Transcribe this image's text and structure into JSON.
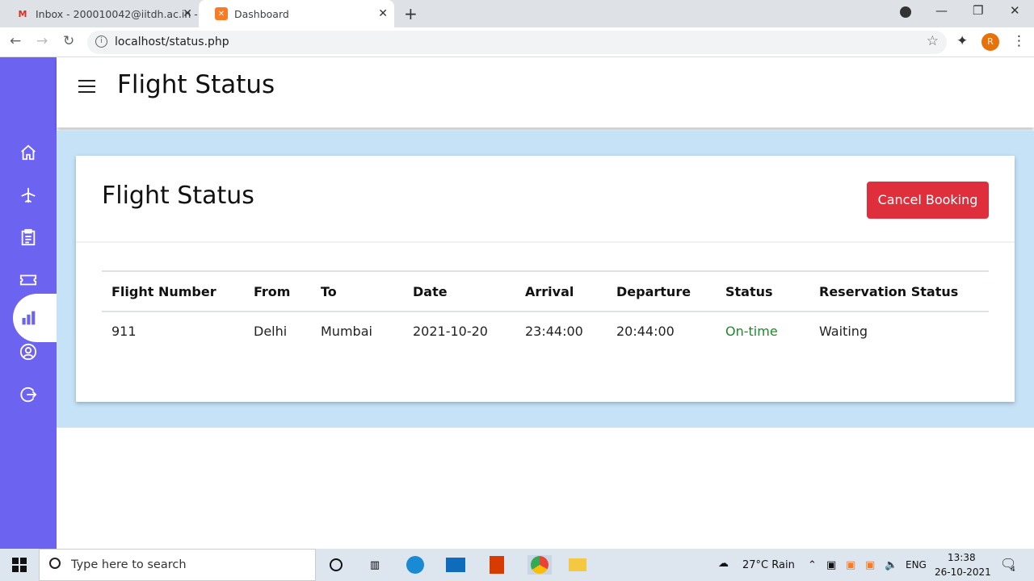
{
  "browser": {
    "tabs": [
      {
        "title": "Inbox - 200010042@iitdh.ac.in - ",
        "favicon": "gmail-icon"
      },
      {
        "title": "Dashboard",
        "favicon": "xampp-icon"
      }
    ],
    "url": "localhost/status.php",
    "profile_initial": "R"
  },
  "app": {
    "header_title": "Flight Status",
    "sidebar": [
      {
        "icon": "home-icon"
      },
      {
        "icon": "plane-icon"
      },
      {
        "icon": "clipboard-icon"
      },
      {
        "icon": "ticket-icon"
      },
      {
        "icon": "bar-chart-icon",
        "active": true
      },
      {
        "icon": "user-circle-icon"
      },
      {
        "icon": "logout-icon"
      }
    ],
    "accent_color": "#6c63f0"
  },
  "card": {
    "title": "Flight Status",
    "cancel_label": "Cancel Booking",
    "columns": [
      "Flight Number",
      "From",
      "To",
      "Date",
      "Arrival",
      "Departure",
      "Status",
      "Reservation Status"
    ],
    "rows": [
      [
        "911",
        "Delhi",
        "Mumbai",
        "2021-10-20",
        "23:44:00",
        "20:44:00",
        "On-time",
        "Waiting"
      ]
    ]
  },
  "taskbar": {
    "search_placeholder": "Type here to search",
    "weather": "27°C  Rain",
    "lang": "ENG",
    "time": "13:38",
    "date": "26-10-2021",
    "notifications": "4"
  }
}
